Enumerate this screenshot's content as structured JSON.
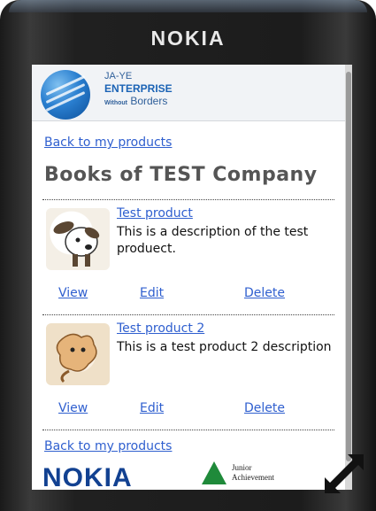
{
  "device": {
    "brand": "NOKIA"
  },
  "logo": {
    "line1": "JA-YE",
    "line2": "ENTERPRISE",
    "line3_small": "Without",
    "line3": "Borders"
  },
  "nav": {
    "back_label": "Back to my products"
  },
  "page": {
    "heading": "Books of TEST Company"
  },
  "products": [
    {
      "name": "Test product",
      "description": "This is a description of the test produect.",
      "image_icon": "dog-icon",
      "actions": {
        "view": "View",
        "edit": "Edit",
        "delete": "Delete"
      }
    },
    {
      "name": "Test product 2",
      "description": "This is a test product 2 description",
      "image_icon": "cat-icon",
      "actions": {
        "view": "View",
        "edit": "Edit",
        "delete": "Delete"
      }
    }
  ],
  "footer": {
    "nokia": "NOKIA",
    "ja_line1": "Junior",
    "ja_line2": "Achievement"
  },
  "colors": {
    "link": "#2f5fcf",
    "heading": "#555555",
    "nokia_blue": "#124191"
  }
}
